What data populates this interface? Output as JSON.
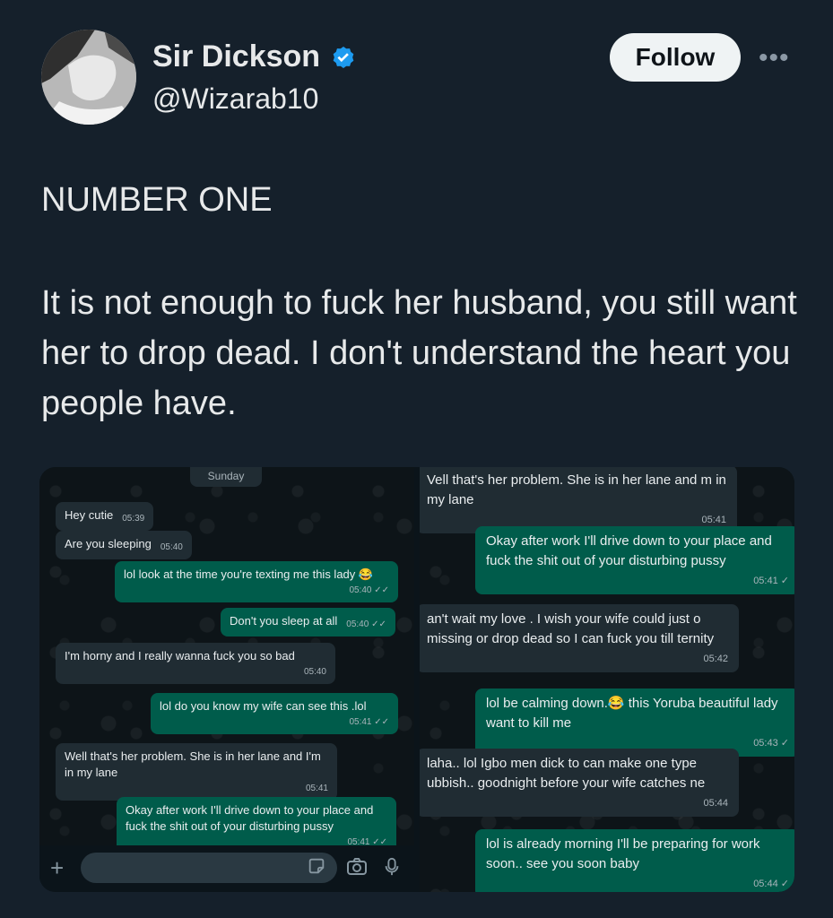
{
  "tweet": {
    "display_name": "Sir Dickson",
    "handle": "@Wizarab10",
    "follow_label": "Follow",
    "more_label": "•••",
    "heading": "NUMBER ONE",
    "text": "It is not enough to fuck her husband, you still want her to drop dead. I don't understand the heart you people have."
  },
  "left_chat": {
    "day": "Sunday",
    "messages": [
      {
        "dir": "in",
        "text": "Hey cutie",
        "time": "05:39"
      },
      {
        "dir": "in",
        "text": "Are you sleeping",
        "time": "05:40"
      },
      {
        "dir": "out",
        "text": "lol look at the time you're texting me this lady 😂",
        "time": "05:40 ✓✓"
      },
      {
        "dir": "out",
        "text": "Don't you sleep at all",
        "time": "05:40 ✓✓"
      },
      {
        "dir": "in",
        "text": "I'm horny and I really wanna fuck you so bad",
        "time": "05:40"
      },
      {
        "dir": "out",
        "text": "lol do you know my wife can see this .lol",
        "time": "05:41 ✓✓"
      },
      {
        "dir": "in",
        "text": "Well that's her problem. She is in her lane and I'm in my lane",
        "time": "05:41"
      },
      {
        "dir": "out",
        "text": "Okay after work I'll drive down to your place and fuck the shit out of your disturbing pussy",
        "time": "05:41 ✓✓"
      }
    ]
  },
  "right_chat": {
    "messages": [
      {
        "dir": "in",
        "text": "Vell that's her problem. She is in her lane and m in my lane",
        "time": "05:41"
      },
      {
        "dir": "out",
        "text": "Okay after work I'll drive down to your place and fuck the shit out of your disturbing pussy",
        "time": "05:41 ✓"
      },
      {
        "dir": "in",
        "text": "an't wait my love . I wish your wife could just o missing or drop dead so I can fuck you till ternity",
        "time": "05:42"
      },
      {
        "dir": "out",
        "text": "lol be calming down.😂 this Yoruba beautiful lady want to kill me",
        "time": "05:43 ✓"
      },
      {
        "dir": "in",
        "text": "laha.. lol Igbo men dick to can make one type ubbish.. goodnight before your wife catches ne",
        "time": "05:44"
      },
      {
        "dir": "out",
        "text": "lol is already morning I'll be preparing for work soon.. see you soon baby",
        "time": "05:44 ✓"
      }
    ]
  },
  "icons": [
    "avatar",
    "verified-badge-icon",
    "more-icon",
    "plus-icon",
    "sticker-icon",
    "camera-icon",
    "mic-icon"
  ],
  "colors": {
    "background": "#15202b",
    "verified": "#1d9bf0",
    "incoming": "#202c33",
    "outgoing": "#005c4b"
  }
}
